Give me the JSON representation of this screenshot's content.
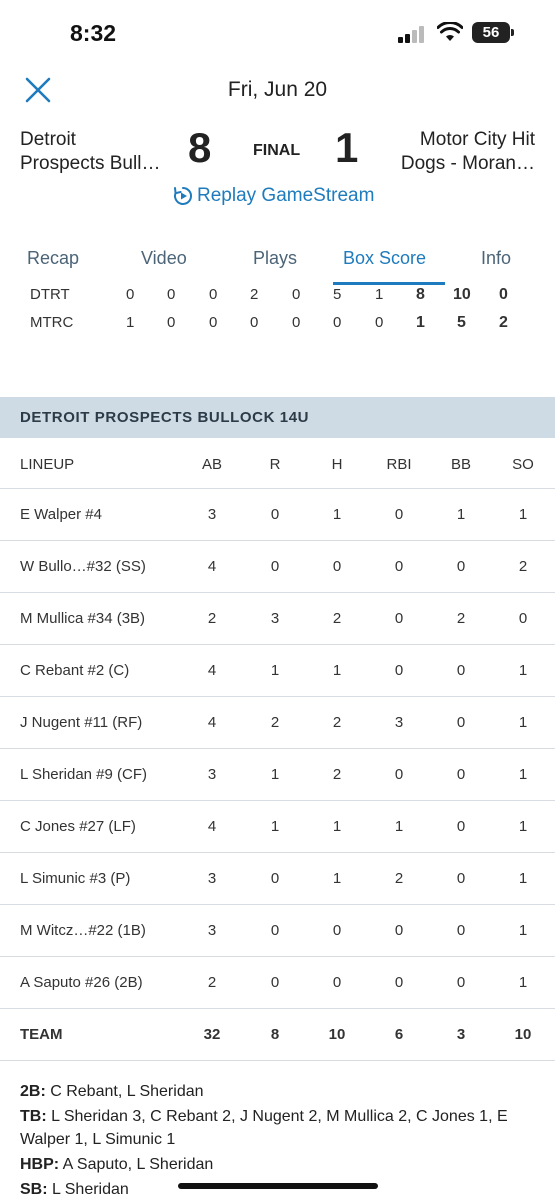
{
  "status_bar": {
    "time": "8:32",
    "battery": "56"
  },
  "header": {
    "date": "Fri, Jun 20"
  },
  "game": {
    "away_team": "Detroit Prospects Bull…",
    "away_team_line1": "Detroit",
    "away_team_line2": "Prospects Bull…",
    "home_team_line1": "Motor City Hit",
    "home_team_line2": "Dogs - Moran…",
    "away_score": "8",
    "home_score": "1",
    "status": "FINAL",
    "replay_label": "Replay GameStream"
  },
  "tabs": [
    {
      "label": "Recap"
    },
    {
      "label": "Video"
    },
    {
      "label": "Plays"
    },
    {
      "label": "Box Score"
    },
    {
      "label": "Info"
    }
  ],
  "linescore": [
    {
      "team": "DTRT",
      "innings": [
        "0",
        "0",
        "0",
        "2",
        "0",
        "5",
        "1"
      ],
      "r": "8",
      "h": "10",
      "e": "0"
    },
    {
      "team": "MTRC",
      "innings": [
        "1",
        "0",
        "0",
        "0",
        "0",
        "0",
        "0"
      ],
      "r": "1",
      "h": "5",
      "e": "2"
    }
  ],
  "section_title": "DETROIT PROSPECTS BULLOCK 14U",
  "lineup_headers": [
    "LINEUP",
    "AB",
    "R",
    "H",
    "RBI",
    "BB",
    "SO"
  ],
  "lineup": [
    {
      "name": "E Walper #4",
      "stats": [
        "3",
        "0",
        "1",
        "0",
        "1",
        "1"
      ]
    },
    {
      "name": "W Bullo…#32 (SS)",
      "stats": [
        "4",
        "0",
        "0",
        "0",
        "0",
        "2"
      ]
    },
    {
      "name": "M Mullica #34 (3B)",
      "stats": [
        "2",
        "3",
        "2",
        "0",
        "2",
        "0"
      ]
    },
    {
      "name": "C Rebant #2 (C)",
      "stats": [
        "4",
        "1",
        "1",
        "0",
        "0",
        "1"
      ]
    },
    {
      "name": "J Nugent #11 (RF)",
      "stats": [
        "4",
        "2",
        "2",
        "3",
        "0",
        "1"
      ]
    },
    {
      "name": "L Sheridan #9 (CF)",
      "stats": [
        "3",
        "1",
        "2",
        "0",
        "0",
        "1"
      ]
    },
    {
      "name": "C Jones #27 (LF)",
      "stats": [
        "4",
        "1",
        "1",
        "1",
        "0",
        "1"
      ]
    },
    {
      "name": "L Simunic #3 (P)",
      "stats": [
        "3",
        "0",
        "1",
        "2",
        "0",
        "1"
      ]
    },
    {
      "name": "M Witcz…#22 (1B)",
      "stats": [
        "3",
        "0",
        "0",
        "0",
        "0",
        "1"
      ]
    },
    {
      "name": "A Saputo #26 (2B)",
      "stats": [
        "2",
        "0",
        "0",
        "0",
        "0",
        "1"
      ]
    }
  ],
  "team_totals": {
    "label": "TEAM",
    "stats": [
      "32",
      "8",
      "10",
      "6",
      "3",
      "10"
    ]
  },
  "notes": [
    {
      "label": "2B:",
      "text": " C Rebant, L Sheridan"
    },
    {
      "label": "TB:",
      "text": " L Sheridan 3, C Rebant 2, J Nugent 2, M Mullica 2, C Jones 1, E Walper 1, L Simunic 1"
    },
    {
      "label": "HBP:",
      "text": " A Saputo, L Sheridan"
    },
    {
      "label": "SB:",
      "text": " L Sheridan"
    }
  ],
  "colors": {
    "accent": "#1e7bbd",
    "section_bg": "#cfdbe4"
  }
}
